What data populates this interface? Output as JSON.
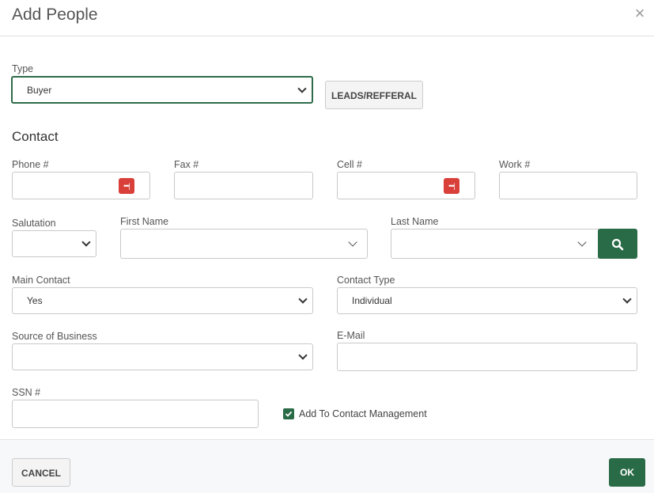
{
  "dialog": {
    "title": "Add People",
    "close_symbol": "×"
  },
  "type_field": {
    "label": "Type",
    "value": "Buyer"
  },
  "leads_button": {
    "label": "LEADS/REFFERAL"
  },
  "contact": {
    "section_title": "Contact",
    "phone": {
      "label": "Phone #",
      "value": ""
    },
    "fax": {
      "label": "Fax #",
      "value": ""
    },
    "cell": {
      "label": "Cell #",
      "value": ""
    },
    "work": {
      "label": "Work #",
      "value": ""
    },
    "salutation": {
      "label": "Salutation",
      "value": ""
    },
    "first_name": {
      "label": "First Name",
      "value": ""
    },
    "last_name": {
      "label": "Last Name",
      "value": ""
    },
    "main_contact": {
      "label": "Main Contact",
      "value": "Yes"
    },
    "contact_type": {
      "label": "Contact Type",
      "value": "Individual"
    },
    "source_of_business": {
      "label": "Source of Business",
      "value": ""
    },
    "email": {
      "label": "E-Mail",
      "value": ""
    },
    "ssn": {
      "label": "SSN #",
      "value": ""
    },
    "add_to_cm": {
      "label": "Add To Contact Management",
      "checked": true
    }
  },
  "footer": {
    "cancel_label": "CANCEL",
    "ok_label": "OK"
  },
  "icons": {
    "password_manager": "password-manager-icon",
    "search": "search-icon",
    "chevron": "chevron-down-icon",
    "close": "close-icon",
    "checkmark": "checkmark-icon"
  },
  "colors": {
    "accent": "#2a6b47",
    "password_icon": "#d9403a"
  }
}
